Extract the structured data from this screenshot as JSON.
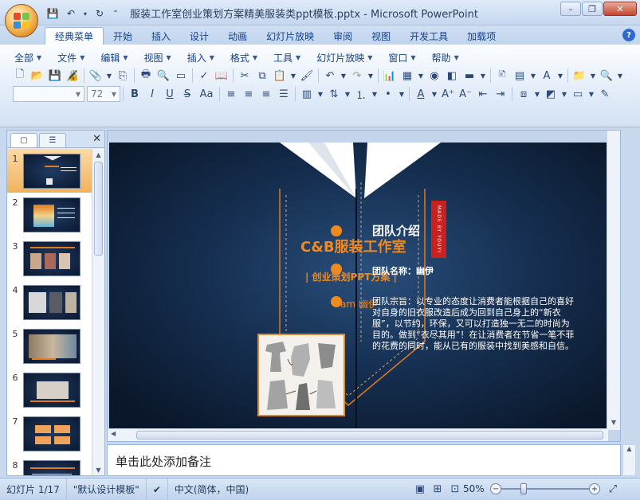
{
  "window": {
    "title": "服装工作室创业策划方案精美服装类ppt模板.pptx - Microsoft PowerPoint",
    "controls": [
      "minimize-icon",
      "restore-icon",
      "close-icon"
    ]
  },
  "quick_access": [
    "save-icon",
    "undo-icon",
    "redo-icon",
    "customize-icon"
  ],
  "ribbon_tabs": [
    {
      "label": "经典菜单",
      "active": true
    },
    {
      "label": "开始"
    },
    {
      "label": "插入"
    },
    {
      "label": "设计"
    },
    {
      "label": "动画"
    },
    {
      "label": "幻灯片放映"
    },
    {
      "label": "审阅"
    },
    {
      "label": "视图"
    },
    {
      "label": "开发工具"
    },
    {
      "label": "加载项"
    }
  ],
  "classic_menus": [
    "全部",
    "文件",
    "编辑",
    "视图",
    "插入",
    "格式",
    "工具",
    "幻灯片放映",
    "窗口",
    "帮助"
  ],
  "format": {
    "font_name": "",
    "font_size": "72"
  },
  "slides_panel": {
    "slides": [
      {
        "number": "1",
        "selected": true
      },
      {
        "number": "2"
      },
      {
        "number": "3"
      },
      {
        "number": "4"
      },
      {
        "number": "5"
      },
      {
        "number": "6"
      },
      {
        "number": "7"
      },
      {
        "number": "8"
      }
    ]
  },
  "slide": {
    "title": "C&B服装工作室",
    "subtitle": "| 创业策划PPT方案 |",
    "am_text": "am 幽伊",
    "team_heading": "团队介绍",
    "team_name": "团队名称：幽伊",
    "team_desc": "团队宗旨：以专业的态度让消费者能根据自己的喜好对自身的旧衣服改造后成为回到自己身上的“新衣服”，以节约，环保，又可以打造独一无二的时尚为目的。做到“衣尽其用”！在让消费者在节省一笔不菲的花费的同时，能从已有的服装中找到美感和自信。",
    "badge": "MADE BY YOUYI",
    "colors": {
      "accent": "#f08a1e",
      "badge": "#c8211f",
      "bg": "#173255"
    }
  },
  "notes": {
    "placeholder": "单击此处添加备注"
  },
  "status": {
    "slide_info": "幻灯片 1/17",
    "theme": "\"默认设计模板\"",
    "language": "中文(简体，中国)",
    "zoom": "50%"
  }
}
